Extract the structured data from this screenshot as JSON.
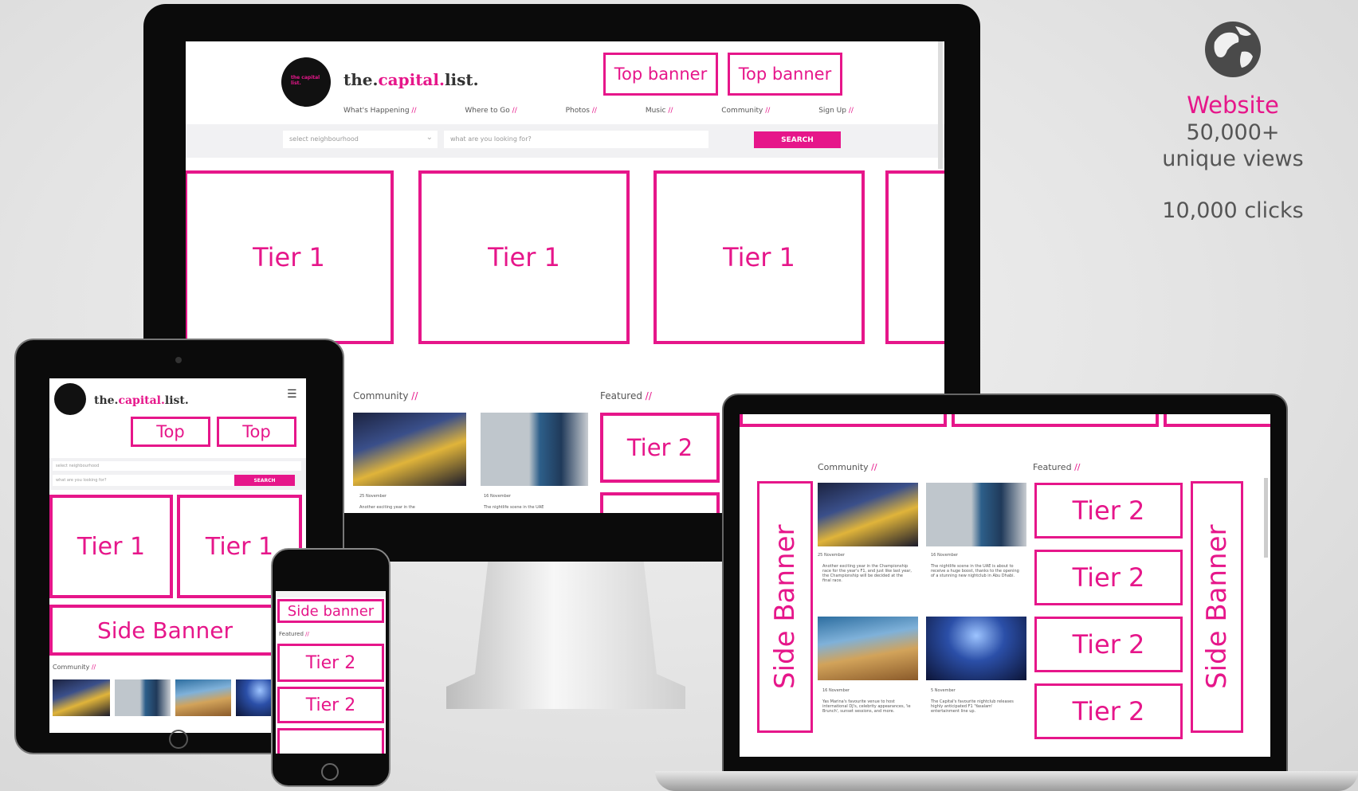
{
  "stats": {
    "label": "Website",
    "views_value": "50,000+",
    "views_label": "unique views",
    "clicks": "10,000 clicks"
  },
  "brand": {
    "part1": "the.",
    "part2": "capital.",
    "part3": "list.",
    "badge": "the capital list."
  },
  "desktop": {
    "top_banners": [
      "Top banner",
      "Top banner"
    ],
    "nav": [
      {
        "label": "What's Happening"
      },
      {
        "label": "Where to Go"
      },
      {
        "label": "Photos"
      },
      {
        "label": "Music"
      },
      {
        "label": "Community"
      },
      {
        "label": "Sign Up"
      }
    ],
    "nav_sep": "//",
    "search": {
      "neighbourhood_placeholder": "select neighbourhood",
      "query_placeholder": "what are you looking for?",
      "button": "SEARCH"
    },
    "tier1": [
      "Tier 1",
      "Tier 1",
      "Tier 1"
    ],
    "community_heading": "Community",
    "featured_heading": "Featured",
    "heading_sep": "//",
    "tier2": "Tier 2",
    "dates": [
      "25 November",
      "16 November"
    ],
    "teasers": [
      "Another exciting year in the",
      "The nightlife scene in the UAE"
    ]
  },
  "tablet": {
    "top_banners": [
      "Top",
      "Top"
    ],
    "search_button": "SEARCH",
    "neighbourhood_placeholder": "select neighbourhood",
    "query_placeholder": "what are you looking for?",
    "tier1": [
      "Tier 1",
      "Tier 1"
    ],
    "side_banner": "Side Banner",
    "community_heading": "Community"
  },
  "phone": {
    "side_banner": "Side banner",
    "featured_heading": "Featured",
    "tier2": [
      "Tier 2",
      "Tier 2"
    ]
  },
  "laptop": {
    "community_heading": "Community",
    "featured_heading": "Featured",
    "side_banner_left": "Side Banner",
    "side_banner_right": "Side Banner",
    "tier2": [
      "Tier 2",
      "Tier 2",
      "Tier 2",
      "Tier 2"
    ],
    "dates": [
      "25 November",
      "16 November",
      "16 November",
      "5 November"
    ],
    "articles": [
      "Another exciting year in the Championship race for the year's F1, and just like last year, the Championship will be decided at the final race.",
      "The nightlife scene in the UAE is about to receive a huge boost, thanks to the opening of a stunning new nightclub in Abu Dhabi.",
      "Yas Marina's favourite venue to host international DJ's, celebrity appearances, 'ie Brunch', sunset sessions, and more.",
      "The Capital's favourite nightclub releases highly anticipated F1 'Yasalam' entertainment line up."
    ]
  }
}
